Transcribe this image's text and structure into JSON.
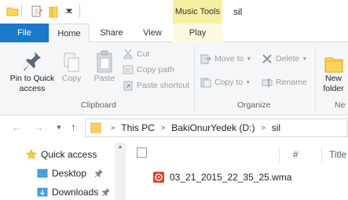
{
  "window": {
    "title": "sil",
    "context_tab_group": "Music Tools"
  },
  "tabs": {
    "file": "File",
    "home": "Home",
    "share": "Share",
    "view": "View",
    "play": "Play"
  },
  "ribbon": {
    "clipboard": {
      "label": "Clipboard",
      "pin_line1": "Pin to Quick",
      "pin_line2": "access",
      "copy": "Copy",
      "paste": "Paste",
      "cut": "Cut",
      "copy_path": "Copy path",
      "paste_shortcut": "Paste shortcut"
    },
    "organize": {
      "label": "Organize",
      "move_to": "Move to",
      "copy_to": "Copy to",
      "delete": "Delete",
      "rename": "Rename"
    },
    "new": {
      "new_line1": "New",
      "new_line2": "folder",
      "group_label_partial": "Ne"
    }
  },
  "address": {
    "crumbs": [
      "This PC",
      "BakiOnurYedek (D:)",
      "sil"
    ]
  },
  "nav_pane": {
    "items": [
      "Quick access",
      "Desktop",
      "Downloads"
    ]
  },
  "content": {
    "columns": {
      "name": "Name",
      "number": "#",
      "title": "Title"
    },
    "files": [
      "03_21_2015_22_35_25.wma"
    ]
  },
  "colors": {
    "file_tab": "#1979ca",
    "music_tools": "#f6f1a2",
    "folder": "#ffd35c",
    "wma_icon": "#d9462f"
  }
}
